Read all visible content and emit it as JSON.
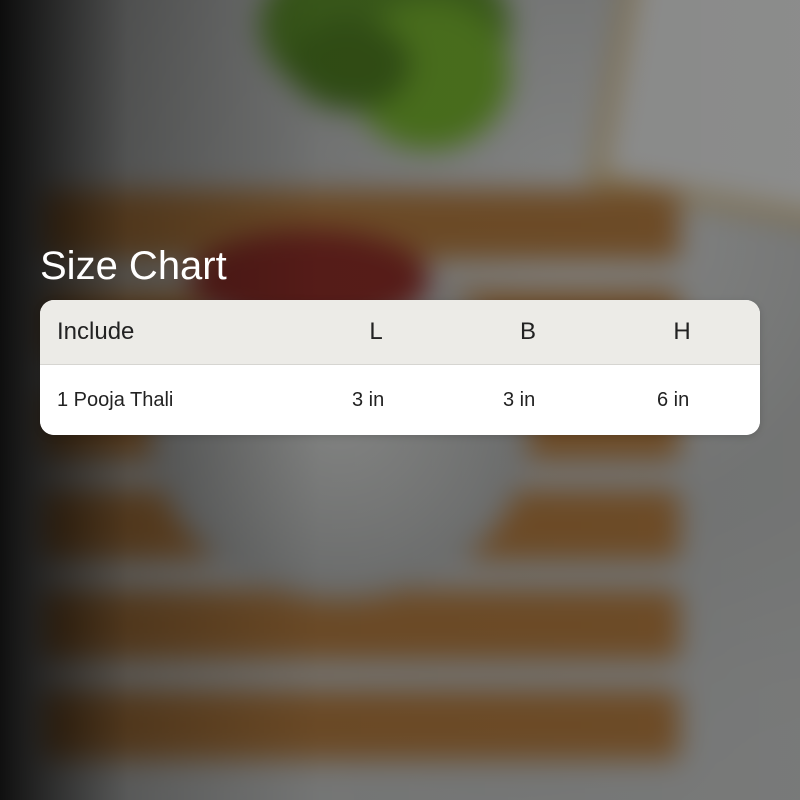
{
  "size_chart": {
    "title": "Size Chart",
    "columns": [
      "Include",
      "L",
      "B",
      "H"
    ],
    "rows": [
      [
        "1 Pooja Thali",
        "3 in",
        "3 in",
        "6 in"
      ]
    ]
  }
}
